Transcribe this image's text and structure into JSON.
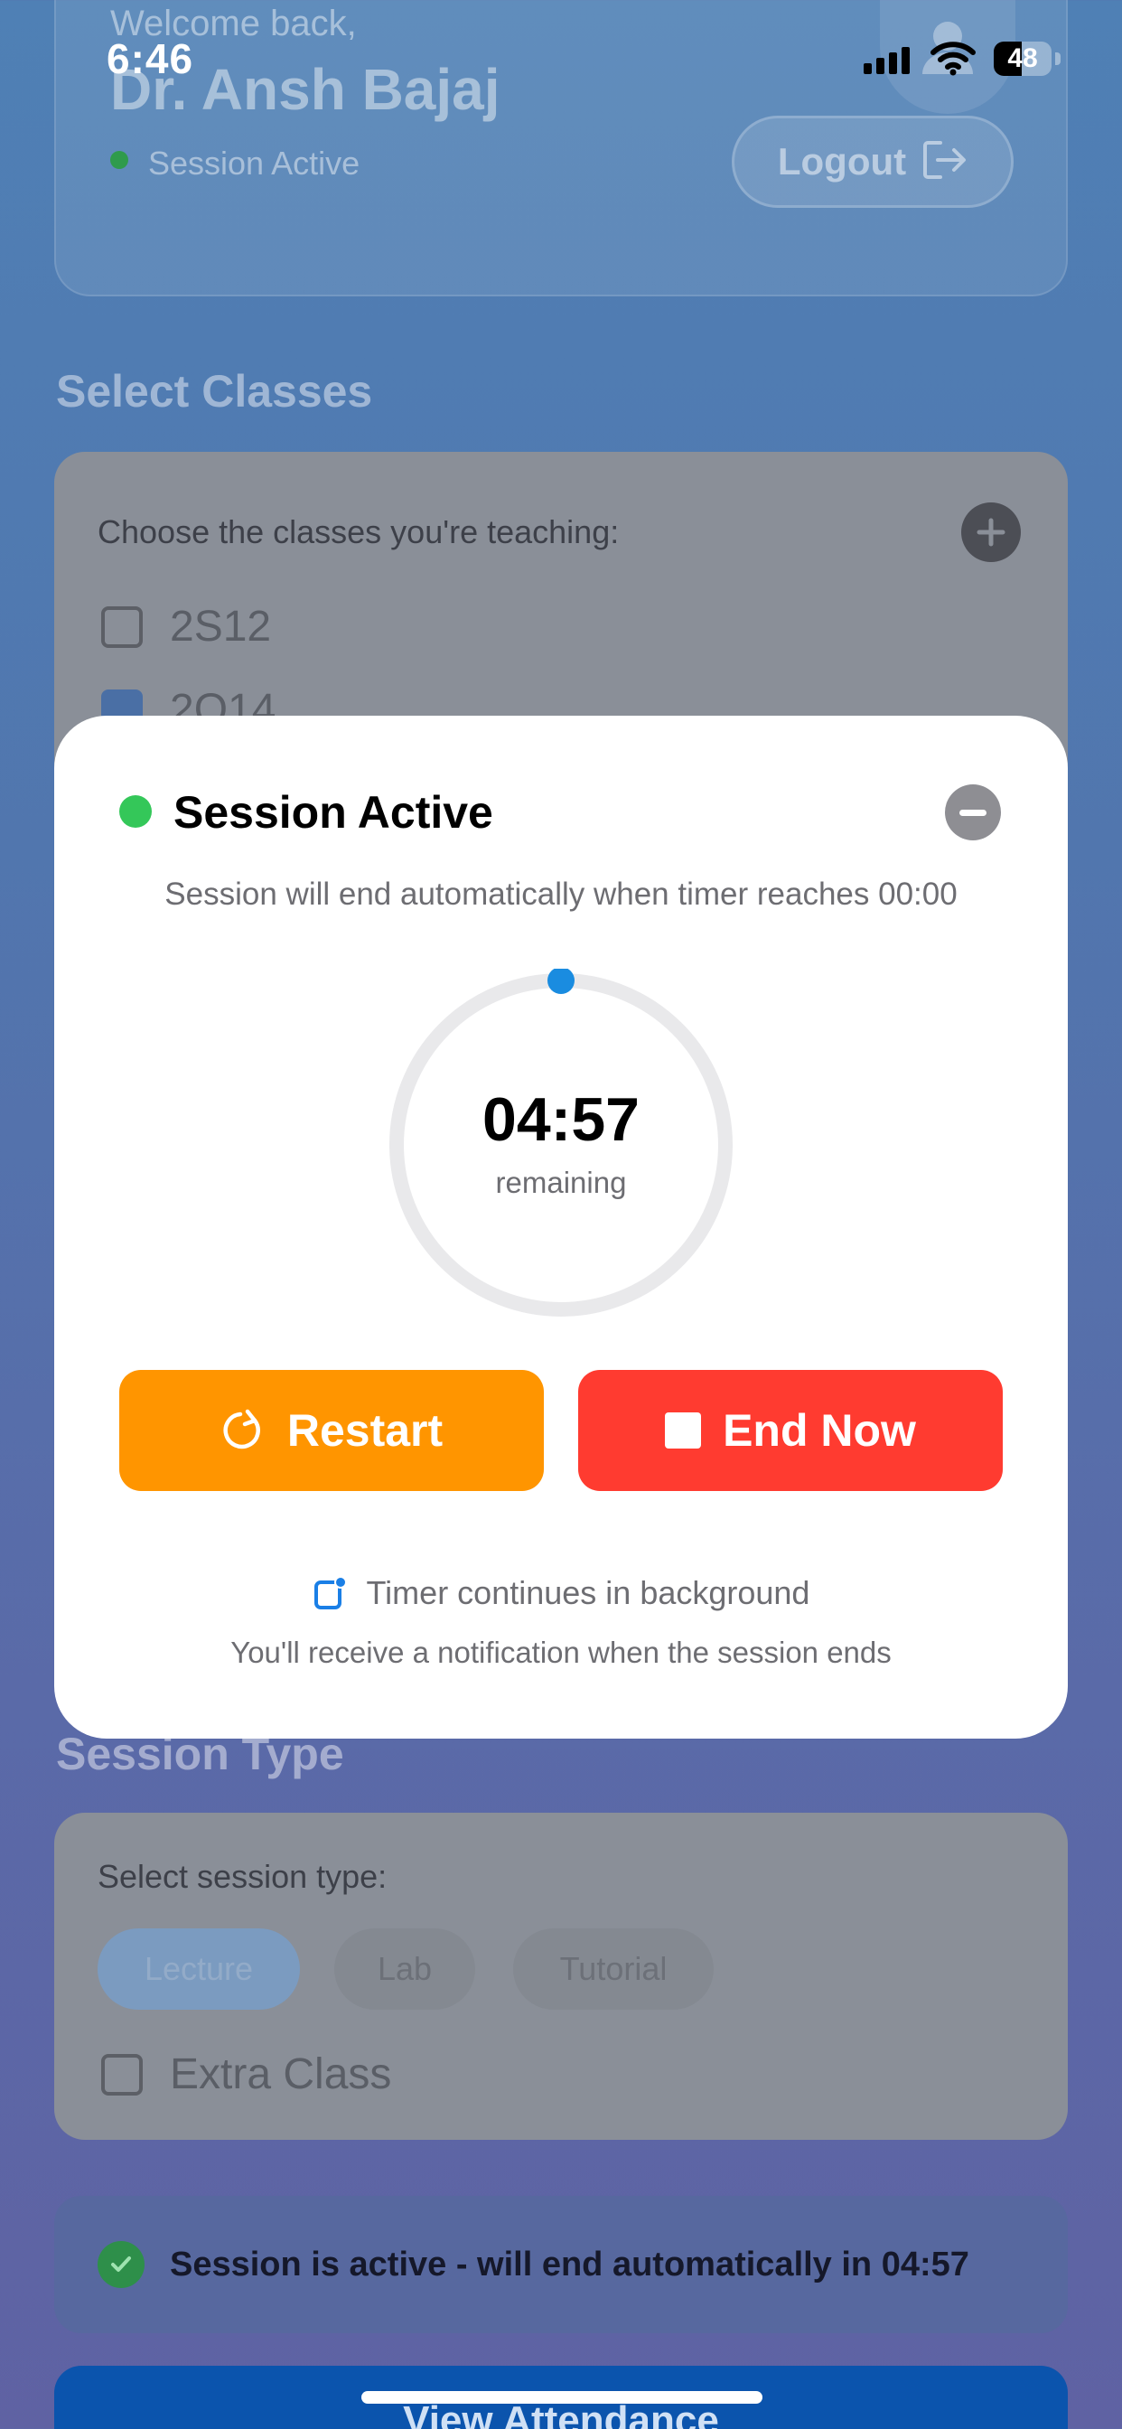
{
  "status_bar": {
    "time": "6:46",
    "battery": "48",
    "battery_level": 0.48
  },
  "header": {
    "welcome": "Welcome back,",
    "doctor_name": "Dr. Ansh Bajaj",
    "session_status": "Session Active",
    "logout_label": "Logout"
  },
  "classes": {
    "section_title": "Select Classes",
    "prompt": "Choose the classes you're teaching:",
    "items": [
      {
        "label": "2S12",
        "checked": false
      },
      {
        "label": "2Q14",
        "checked": true
      }
    ]
  },
  "modal": {
    "title": "Session Active",
    "subtitle": "Session will end automatically when timer reaches 00:00",
    "timer": "04:57",
    "timer_label": "remaining",
    "restart_label": "Restart",
    "end_label": "End Now",
    "background_note": "Timer continues in background",
    "notify_note": "You'll receive a notification when the session ends"
  },
  "session_type": {
    "section_title": "Session Type",
    "prompt": "Select session type:",
    "options": [
      "Lecture",
      "Lab",
      "Tutorial"
    ],
    "selected": "Lecture",
    "extra_class_label": "Extra Class"
  },
  "status_banner": {
    "text": "Session is active - will end automatically in 04:57"
  },
  "footer": {
    "view_button_label": "View Attendance"
  },
  "colors": {
    "accent_blue": "#0b54ad",
    "active_green": "#34c759",
    "restart_orange": "#ff9500",
    "end_red": "#ff3b30"
  }
}
